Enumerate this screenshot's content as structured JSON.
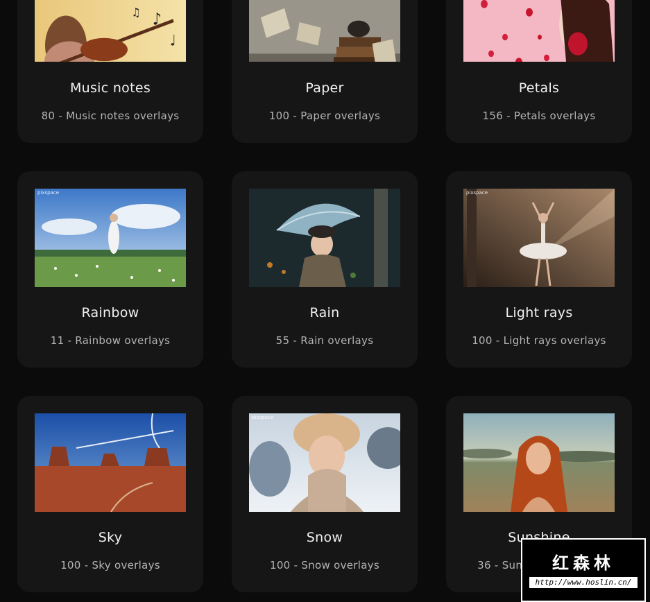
{
  "cards": [
    {
      "title": "Music notes",
      "subtitle": "80 - Music notes overlays",
      "icon": "music-notes-photo"
    },
    {
      "title": "Paper",
      "subtitle": "100 - Paper overlays",
      "icon": "paper-photo"
    },
    {
      "title": "Petals",
      "subtitle": "156 - Petals overlays",
      "icon": "petals-photo"
    },
    {
      "title": "Rainbow",
      "subtitle": "11 - Rainbow overlays",
      "icon": "rainbow-photo",
      "watermark": "pixspace"
    },
    {
      "title": "Rain",
      "subtitle": "55 - Rain overlays",
      "icon": "rain-photo"
    },
    {
      "title": "Light rays",
      "subtitle": "100 - Light rays overlays",
      "icon": "light-rays-photo",
      "watermark": "pixspace"
    },
    {
      "title": "Sky",
      "subtitle": "100 - Sky overlays",
      "icon": "sky-photo"
    },
    {
      "title": "Snow",
      "subtitle": "100 - Snow overlays",
      "icon": "snow-photo",
      "watermark": "pixspace"
    },
    {
      "title": "Sunshine",
      "subtitle": "36 - Sunshine overlays",
      "icon": "sunshine-photo"
    }
  ],
  "watermark_logo": {
    "text": "红森林",
    "url": "http://www.hoslin.cn/"
  },
  "colors": {
    "background": "#0b0b0b",
    "card": "#161616",
    "title": "#f2f2f2",
    "subtitle": "#b4b4b4"
  }
}
